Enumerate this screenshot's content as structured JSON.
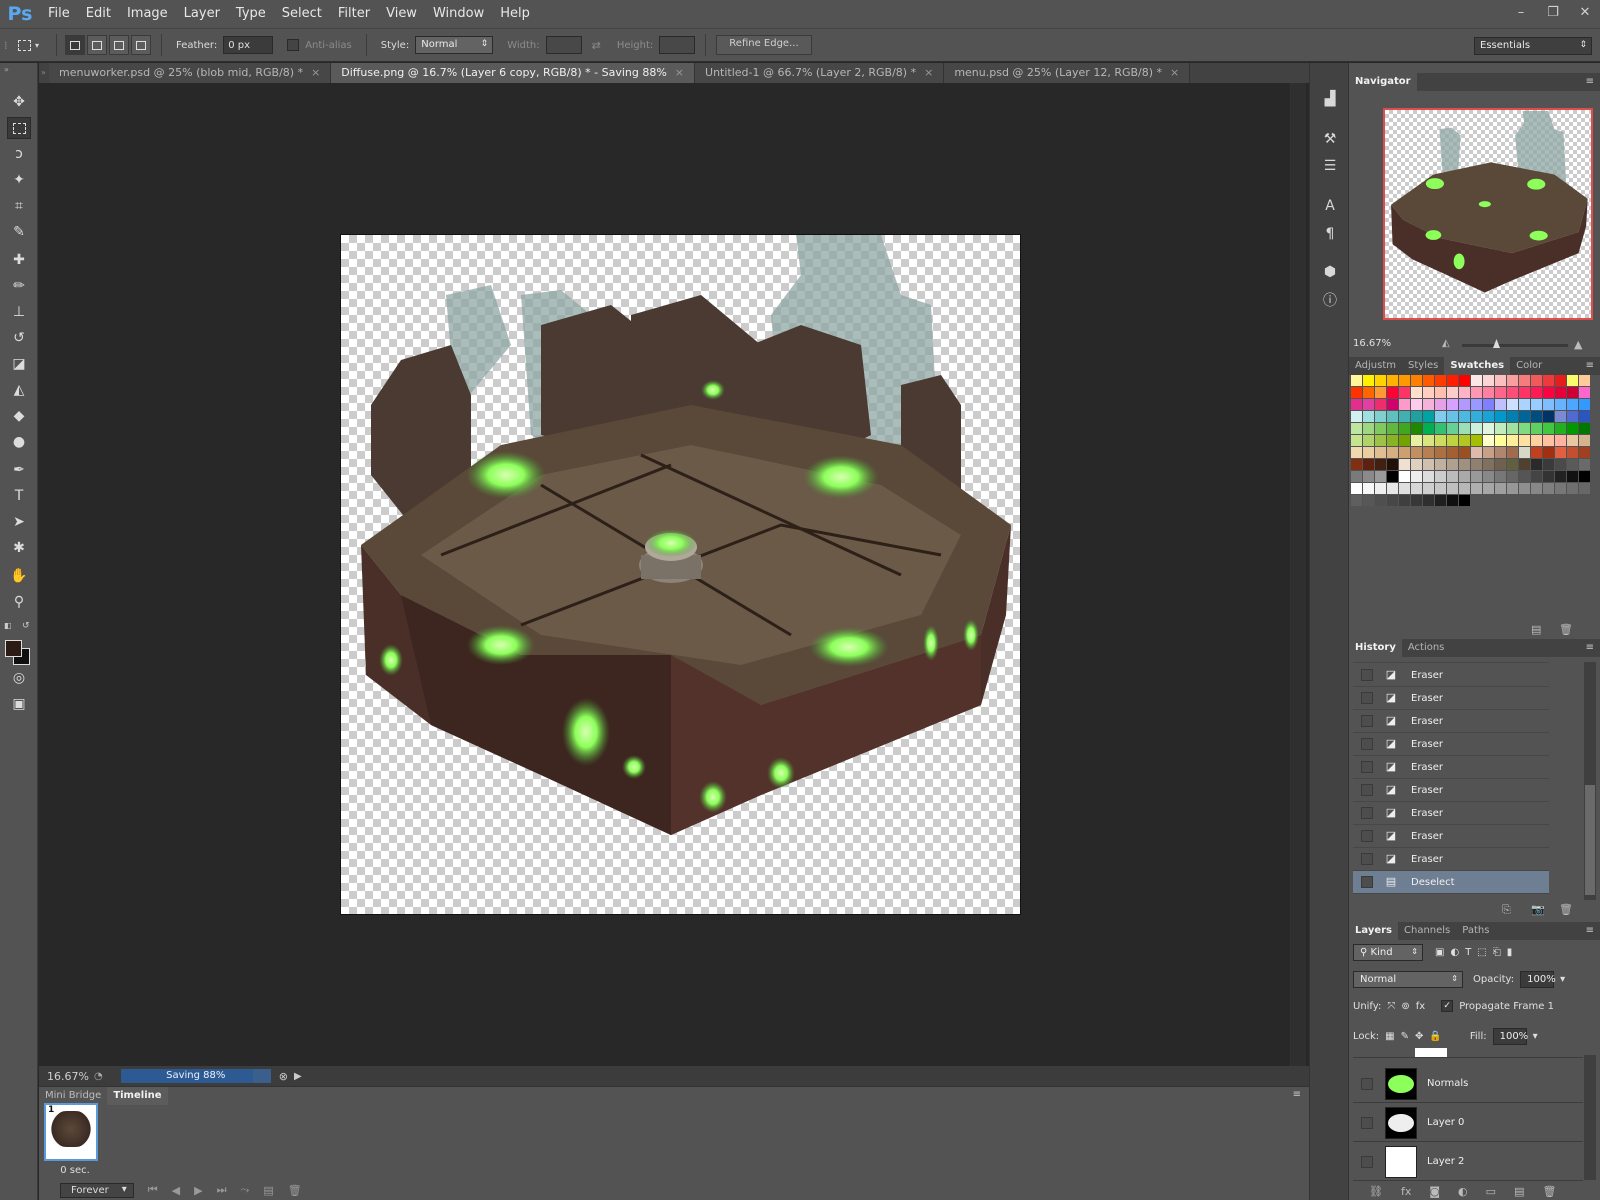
{
  "app": {
    "logo": "Ps"
  },
  "menu": [
    "File",
    "Edit",
    "Image",
    "Layer",
    "Type",
    "Select",
    "Filter",
    "View",
    "Window",
    "Help"
  ],
  "options": {
    "feather_label": "Feather:",
    "feather_value": "0 px",
    "antialias_label": "Anti-alias",
    "style_label": "Style:",
    "style_value": "Normal",
    "width_label": "Width:",
    "height_label": "Height:",
    "refine_label": "Refine Edge...",
    "workspace": "Essentials"
  },
  "tabs": [
    {
      "label": "menuworker.psd @ 25% (blob mid, RGB/8) *",
      "active": false
    },
    {
      "label": "Diffuse.png @ 16.7% (Layer 6 copy, RGB/8) * - Saving 88%",
      "active": true
    },
    {
      "label": "Untitled-1 @ 66.7% (Layer 2, RGB/8) *",
      "active": false
    },
    {
      "label": "menu.psd @ 25% (Layer 12, RGB/8) *",
      "active": false
    }
  ],
  "status": {
    "zoom": "16.67%",
    "progress_label": "Saving 88%",
    "progress": 0.88
  },
  "timeline": {
    "tabs": [
      "Mini Bridge",
      "Timeline"
    ],
    "frame_number": "1",
    "frame_duration": "0 sec.",
    "loop": "Forever"
  },
  "navigator": {
    "title": "Navigator",
    "zoom": "16.67%"
  },
  "swatch_tabs": [
    "Adjustm",
    "Styles",
    "Swatches",
    "Color"
  ],
  "swatch_colors": [
    "#fff799",
    "#fff200",
    "#ffd200",
    "#ffb300",
    "#ff9900",
    "#ff7f00",
    "#ff5a00",
    "#ff3c00",
    "#ff1e00",
    "#ff0000",
    "#fde8e8",
    "#fcd5d5",
    "#fabfbf",
    "#f79e9e",
    "#f47c7c",
    "#f05a5a",
    "#ed3b3b",
    "#e61d1d",
    "#fbfc6c",
    "#ffcc99",
    "#ff3300",
    "#ff6600",
    "#ff9933",
    "#ff0033",
    "#ff3366",
    "#ffe0cc",
    "#ffd0c0",
    "#ffc0b0",
    "#ffcccc",
    "#ffb3c6",
    "#ff99b3",
    "#ff809f",
    "#ff668c",
    "#ff4d79",
    "#ff3366",
    "#ff1a53",
    "#ff0040",
    "#e6003a",
    "#cc0033",
    "#ff66cc",
    "#e0308c",
    "#e040a0",
    "#ee2d6e",
    "#d1006b",
    "#ff99cc",
    "#ffccee",
    "#f5b3d9",
    "#e6a0e6",
    "#d8a0ff",
    "#b399ff",
    "#9999ff",
    "#8080ff",
    "#c0c0ff",
    "#cce0ff",
    "#aad4ff",
    "#99ccff",
    "#80bfff",
    "#66b3ff",
    "#4da6ff",
    "#3399ff",
    "#d3f0f0",
    "#a0e0e0",
    "#80d0d0",
    "#60c0c0",
    "#40b0b0",
    "#20a0a0",
    "#00a3a3",
    "#80ccee",
    "#66c2e6",
    "#4db8e0",
    "#33aedb",
    "#1aa3d6",
    "#0099cc",
    "#0080b3",
    "#006699",
    "#004d80",
    "#003366",
    "#7a8bd4",
    "#4f6ad0",
    "#2b55c0",
    "#bfe6a0",
    "#9fd680",
    "#80c860",
    "#60b840",
    "#40a820",
    "#208800",
    "#00b050",
    "#33c073",
    "#66d096",
    "#99e0b9",
    "#ccf0dc",
    "#e0f5e0",
    "#c0ecc0",
    "#a0e3a0",
    "#80da80",
    "#60d160",
    "#40c840",
    "#20b020",
    "#009900",
    "#007700",
    "#c6e38f",
    "#b1d36b",
    "#9cc348",
    "#87b324",
    "#72a300",
    "#e6f0a0",
    "#d9e680",
    "#ccdc60",
    "#bfd240",
    "#b2c820",
    "#a5be00",
    "#ffffcc",
    "#ffff99",
    "#ffef99",
    "#ffe0a0",
    "#ffd1a0",
    "#ffc2a0",
    "#ffb3a0",
    "#e8c8a0",
    "#d4b48c",
    "#f0d8b0",
    "#ead0a0",
    "#e0c090",
    "#d6b080",
    "#cca070",
    "#c29060",
    "#b88050",
    "#ae7040",
    "#a46030",
    "#9a5020",
    "#ddbbaa",
    "#c8a088",
    "#b08670",
    "#a06c50",
    "#d8d8c8",
    "#c04020",
    "#a03010",
    "#e06040",
    "#c05030",
    "#a04020",
    "#803010",
    "#602010",
    "#402010",
    "#201008",
    "#f0e0d0",
    "#e0d0c0",
    "#d0c0b0",
    "#c0b0a0",
    "#b0a090",
    "#a09080",
    "#908070",
    "#807060",
    "#706050",
    "#606040",
    "#504030",
    "#2a2a2a",
    "#3a3a3a",
    "#4a4a4a",
    "#5a5a5a",
    "#6a6a6a",
    "#7a7a7a",
    "#8a8a8a",
    "#9a9a9a",
    "#000000",
    "#ffffff",
    "#eeeeee",
    "#dddddd",
    "#cccccc",
    "#bbbbbb",
    "#aaaaaa",
    "#999999",
    "#888888",
    "#777777",
    "#666666",
    "#555555",
    "#444444",
    "#333333",
    "#222222",
    "#111111",
    "#000000",
    "#ffffff",
    "#f7f7f7",
    "#efefef",
    "#e7e7e7",
    "#dfdfdf",
    "#d7d7d7",
    "#cfcfcf",
    "#c7c7c7",
    "#bfbfbf",
    "#b7b7b7",
    "#afafaf",
    "#a7a7a7",
    "#9f9f9f",
    "#979797",
    "#8f8f8f",
    "#878787",
    "#7f7f7f",
    "#777777",
    "#6f6f6f",
    "#676767",
    "#5f5f5f",
    "#575757",
    "#4f4f4f",
    "#474747",
    "#3f3f3f",
    "#373737",
    "#2f2f2f",
    "#1f1f1f",
    "#0f0f0f",
    "#000000"
  ],
  "history": {
    "tabs": [
      "History",
      "Actions"
    ],
    "items": [
      "Eraser",
      "Eraser",
      "Eraser",
      "Eraser",
      "Eraser",
      "Eraser",
      "Eraser",
      "Eraser",
      "Eraser",
      "Deselect"
    ],
    "selected_index": 9
  },
  "layers": {
    "tabs": [
      "Layers",
      "Channels",
      "Paths"
    ],
    "filter": "Kind",
    "blend": "Normal",
    "opacity_label": "Opacity:",
    "opacity": "100%",
    "unify_label": "Unify:",
    "propagate_label": "Propagate Frame 1",
    "lock_label": "Lock:",
    "fill_label": "Fill:",
    "fill": "100%",
    "items": [
      {
        "name": "Normals"
      },
      {
        "name": "Layer 0"
      },
      {
        "name": "Layer 2"
      }
    ]
  },
  "colors": {
    "accent": "#2d5a92",
    "nav_frame": "#e04b4b",
    "glow": "#8cff5a"
  }
}
